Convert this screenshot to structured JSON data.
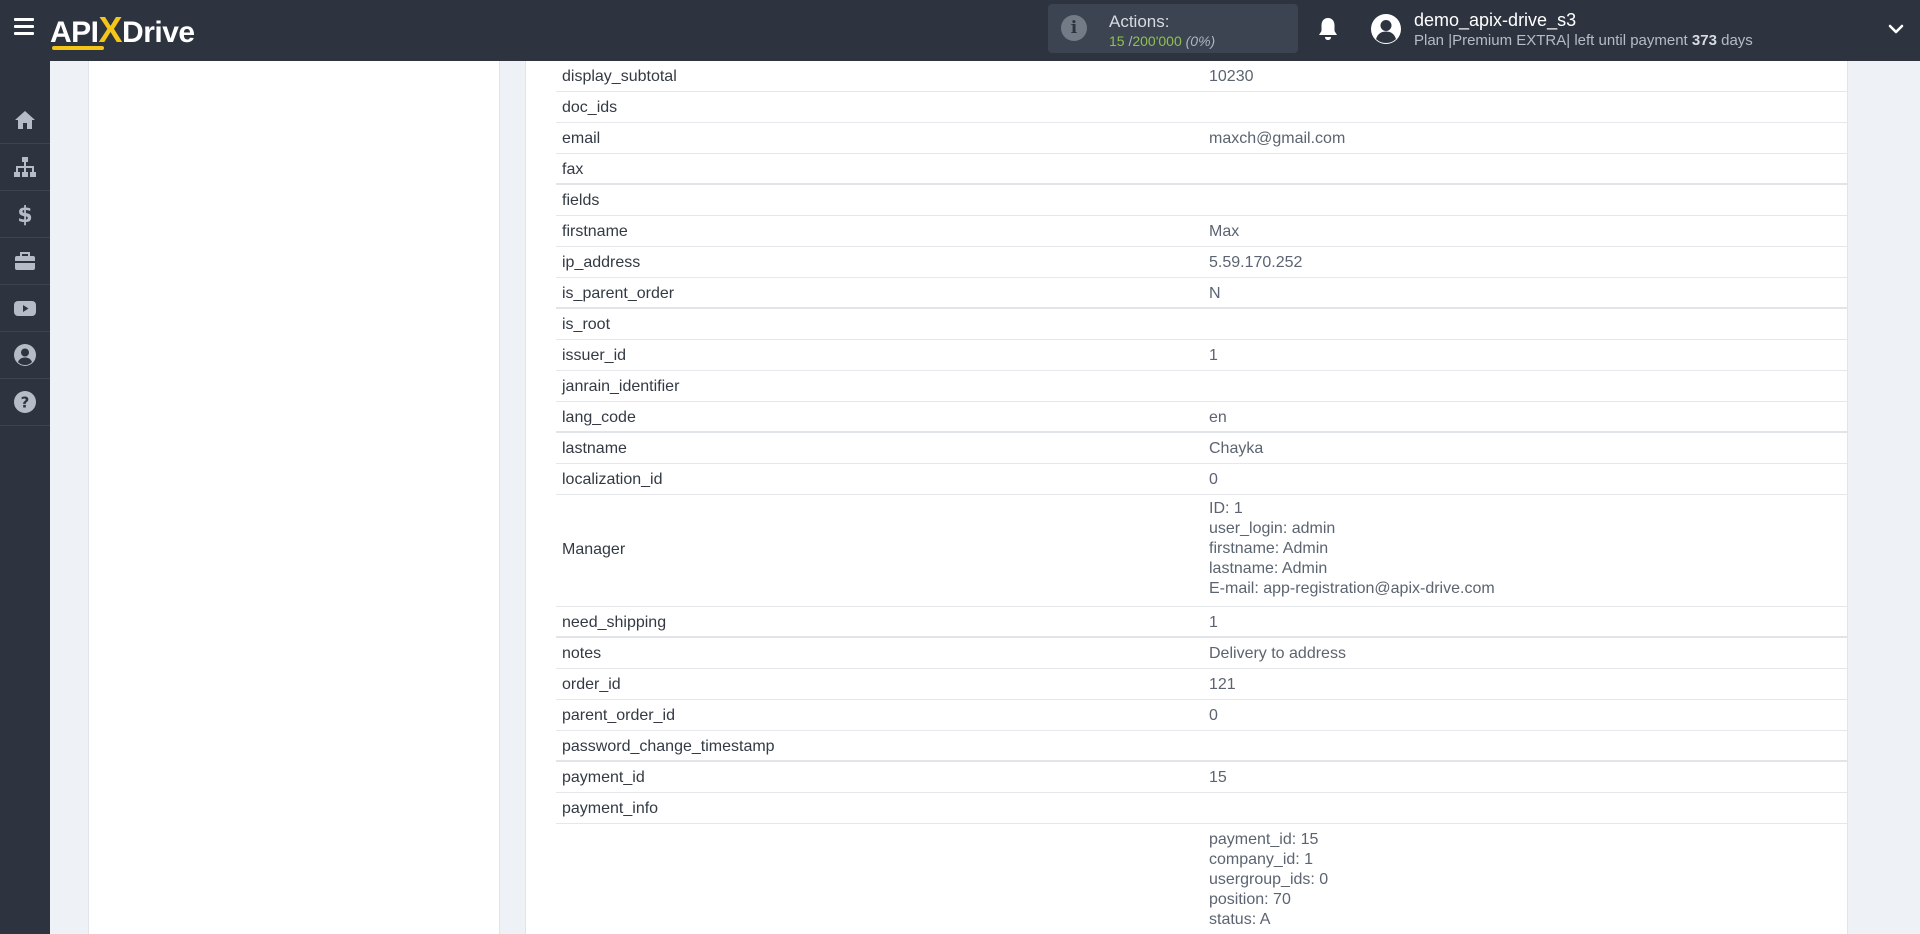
{
  "header": {
    "logo_text_a": "API",
    "logo_text_x": "X",
    "logo_text_b": "Drive",
    "actions_label": "Actions:",
    "actions_used": "15",
    "actions_sep": "/",
    "actions_total": "200'000",
    "actions_pct": "(0%)",
    "user_name": "demo_apix-drive_s3",
    "plan_prefix": "Plan |Premium EXTRA| left until payment",
    "plan_days": "373",
    "plan_suffix": "days"
  },
  "sidebar": {
    "items": [
      {
        "icon": "home-icon"
      },
      {
        "icon": "sitemap-icon"
      },
      {
        "icon": "dollar-icon"
      },
      {
        "icon": "briefcase-icon"
      },
      {
        "icon": "youtube-icon"
      },
      {
        "icon": "user-circle-icon"
      },
      {
        "icon": "question-circle-icon"
      }
    ]
  },
  "fields": [
    {
      "key": "display_subtotal",
      "value": "10230"
    },
    {
      "key": "doc_ids",
      "value": ""
    },
    {
      "key": "email",
      "value": "maxch@gmail.com"
    },
    {
      "key": "fax",
      "value": ""
    },
    {
      "key": "fields",
      "value": ""
    },
    {
      "key": "firstname",
      "value": "Max"
    },
    {
      "key": "ip_address",
      "value": "5.59.170.252"
    },
    {
      "key": "is_parent_order",
      "value": "N"
    },
    {
      "key": "is_root",
      "value": ""
    },
    {
      "key": "issuer_id",
      "value": "1"
    },
    {
      "key": "janrain_identifier",
      "value": ""
    },
    {
      "key": "lang_code",
      "value": "en"
    },
    {
      "key": "lastname",
      "value": "Chayka"
    },
    {
      "key": "localization_id",
      "value": "0"
    }
  ],
  "manager": {
    "key": "Manager",
    "lines": [
      "ID: 1",
      "user_login: admin",
      "firstname: Admin",
      "lastname: Admin",
      "E-mail: app-registration@apix-drive.com"
    ]
  },
  "fields2": [
    {
      "key": "need_shipping",
      "value": "1"
    },
    {
      "key": "notes",
      "value": "Delivery to address"
    },
    {
      "key": "order_id",
      "value": "121"
    },
    {
      "key": "parent_order_id",
      "value": "0"
    },
    {
      "key": "password_change_timestamp",
      "value": ""
    },
    {
      "key": "payment_id",
      "value": "15"
    },
    {
      "key": "payment_info",
      "value": ""
    }
  ],
  "payment_details": {
    "lines": [
      "payment_id: 15",
      "company_id: 1",
      "usergroup_ids: 0",
      "position: 70",
      "status: A"
    ]
  },
  "colors": {
    "topbar": "#2d3440",
    "accent_yellow": "#f5c518",
    "actions_green": "#8fc04f"
  }
}
